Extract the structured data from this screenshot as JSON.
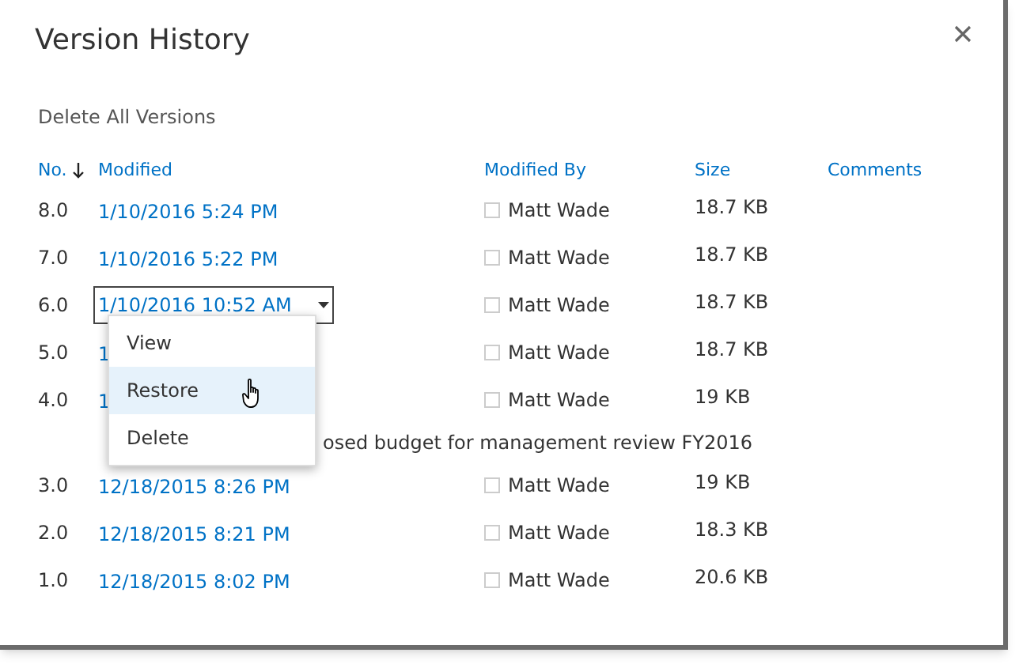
{
  "dialog": {
    "title": "Version History",
    "actions": [
      "Delete All Versions"
    ]
  },
  "columns": [
    {
      "label": "No.",
      "sorted": true
    },
    {
      "label": "Modified",
      "sorted": false
    },
    {
      "label": "Modified By",
      "sorted": false
    },
    {
      "label": "Size",
      "sorted": false
    },
    {
      "label": "Comments",
      "sorted": false
    }
  ],
  "rows": [
    {
      "kind": "version",
      "no": "8.0",
      "modified": "1/10/2016 5:24 PM",
      "modified_by": "Matt Wade",
      "size": "18.7 KB",
      "menu_open": false
    },
    {
      "kind": "version",
      "no": "7.0",
      "modified": "1/10/2016 5:22 PM",
      "modified_by": "Matt Wade",
      "size": "18.7 KB",
      "menu_open": false
    },
    {
      "kind": "version",
      "no": "6.0",
      "modified": "1/10/2016 10:52 AM",
      "modified_by": "Matt Wade",
      "size": "18.7 KB",
      "menu_open": true
    },
    {
      "kind": "version",
      "no": "5.0",
      "modified": "1",
      "modified_by": "Matt Wade",
      "size": "18.7 KB",
      "menu_open": false
    },
    {
      "kind": "version",
      "no": "4.0",
      "modified": "1",
      "modified_by": "Matt Wade",
      "size": "19 KB",
      "menu_open": false
    },
    {
      "kind": "comment",
      "text": "osed budget for management review FY2016"
    },
    {
      "kind": "version",
      "no": "3.0",
      "modified": "12/18/2015 8:26 PM",
      "modified_by": "Matt Wade",
      "size": "19 KB",
      "menu_open": false
    },
    {
      "kind": "version",
      "no": "2.0",
      "modified": "12/18/2015 8:21 PM",
      "modified_by": "Matt Wade",
      "size": "18.3 KB",
      "menu_open": false
    },
    {
      "kind": "version",
      "no": "1.0",
      "modified": "12/18/2015 8:02 PM",
      "modified_by": "Matt Wade",
      "size": "20.6 KB",
      "menu_open": false
    }
  ],
  "context_menu": {
    "items": [
      {
        "label": "View",
        "selected": false
      },
      {
        "label": "Restore",
        "selected": true
      },
      {
        "label": "Delete",
        "selected": false
      }
    ]
  }
}
